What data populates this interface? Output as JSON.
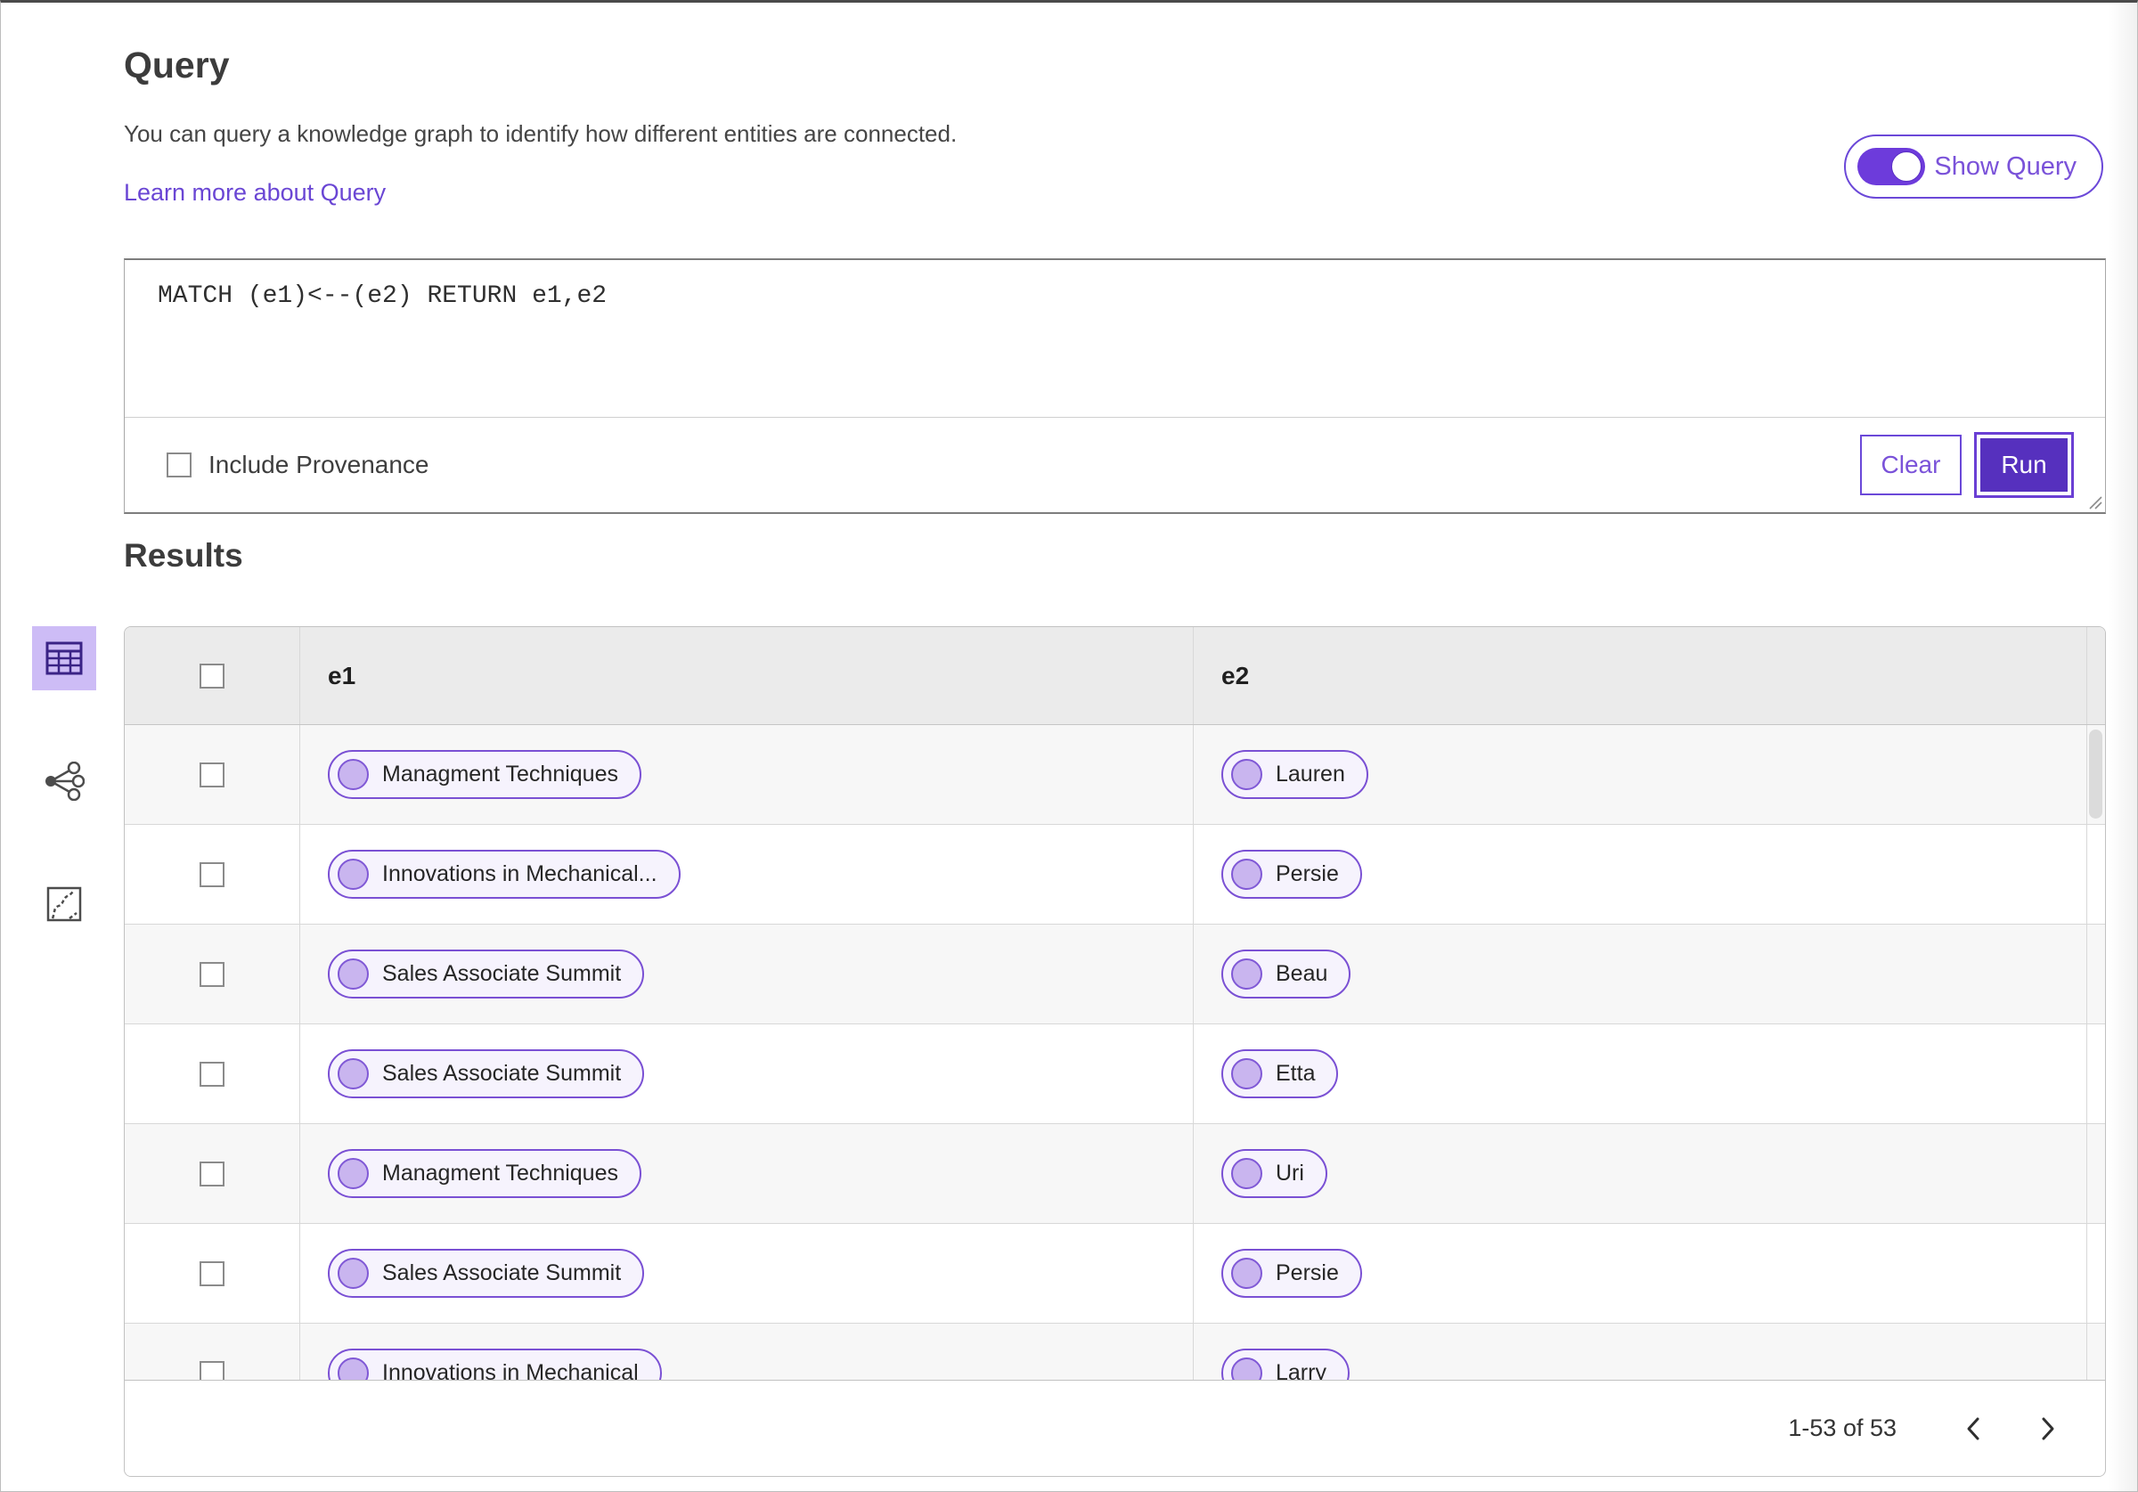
{
  "header": {
    "title": "Query",
    "description": "You can query a knowledge graph to identify how different entities are connected.",
    "learn_more_link": "Learn more about Query",
    "show_query_toggle": {
      "label": "Show Query",
      "state": "on"
    }
  },
  "query_editor": {
    "text": "MATCH (e1)<--(e2) RETURN e1,e2",
    "include_provenance": {
      "label": "Include Provenance",
      "checked": false
    },
    "clear_button_label": "Clear",
    "run_button_label": "Run"
  },
  "results": {
    "title": "Results",
    "view_switcher": {
      "icons": [
        "table-view-icon",
        "graph-view-icon",
        "map-view-icon"
      ],
      "active": "table-view-icon"
    },
    "table": {
      "columns": [
        "e1",
        "e2"
      ],
      "rows": [
        {
          "e1": "Managment Techniques",
          "e2": "Lauren"
        },
        {
          "e1": "Innovations in Mechanical...",
          "e2": "Persie"
        },
        {
          "e1": "Sales Associate Summit",
          "e2": "Beau"
        },
        {
          "e1": "Sales Associate Summit",
          "e2": "Etta"
        },
        {
          "e1": "Managment Techniques",
          "e2": "Uri"
        },
        {
          "e1": "Sales Associate Summit",
          "e2": "Persie"
        },
        {
          "e1": "Innovations in Mechanical",
          "e2": "Larry"
        }
      ],
      "pagination": {
        "range_label": "1-53 of 53"
      }
    }
  },
  "colors": {
    "accent_purple": "#6b48d8",
    "run_button_fill": "#5630be",
    "toggle_fill": "#6d3bdb",
    "active_tile_bg": "#cdbcf6",
    "pill_border": "#7a50d4",
    "pill_bg": "#f6f3fd",
    "pill_dot_fill": "#c9b5ef",
    "table_header_bg": "#ebebeb",
    "row_alt_bg": "#f7f7f7"
  }
}
